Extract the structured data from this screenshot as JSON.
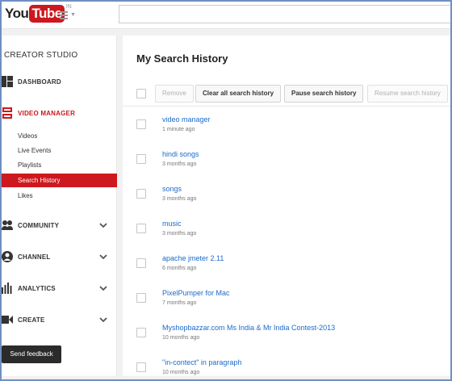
{
  "header": {
    "logo_you": "You",
    "logo_tube": "Tube",
    "logo_region": "IN"
  },
  "sidebar": {
    "studio_title": "CREATOR STUDIO",
    "sections": {
      "dashboard": "DASHBOARD",
      "video_manager": "VIDEO MANAGER",
      "community": "COMMUNITY",
      "channel": "CHANNEL",
      "analytics": "ANALYTICS",
      "create": "CREATE"
    },
    "video_manager_items": [
      "Videos",
      "Live Events",
      "Playlists",
      "Search History",
      "Likes"
    ],
    "selected_item": "Search History",
    "feedback": "Send feedback"
  },
  "main": {
    "title": "My Search History",
    "toolbar": {
      "remove": "Remove",
      "clear_all": "Clear all search history",
      "pause": "Pause search history",
      "resume": "Resume search history"
    },
    "history": [
      {
        "query": "video manager",
        "time": "1 minute ago"
      },
      {
        "query": "hindi songs",
        "time": "3 months ago"
      },
      {
        "query": "songs",
        "time": "3 months ago"
      },
      {
        "query": "music",
        "time": "3 months ago"
      },
      {
        "query": "apache jmeter 2.11",
        "time": "6 months ago"
      },
      {
        "query": "PixelPumper for Mac",
        "time": "7 months ago"
      },
      {
        "query": "Myshopbazzar.com Ms India & Mr India Contest-2013",
        "time": "10 months ago"
      },
      {
        "query": "\"in-contect\" in paragraph",
        "time": "10 months ago"
      }
    ]
  },
  "colors": {
    "brand_red": "#cc181e",
    "link_blue": "#1b6ac9",
    "frame_blue": "#6f8fc0"
  }
}
